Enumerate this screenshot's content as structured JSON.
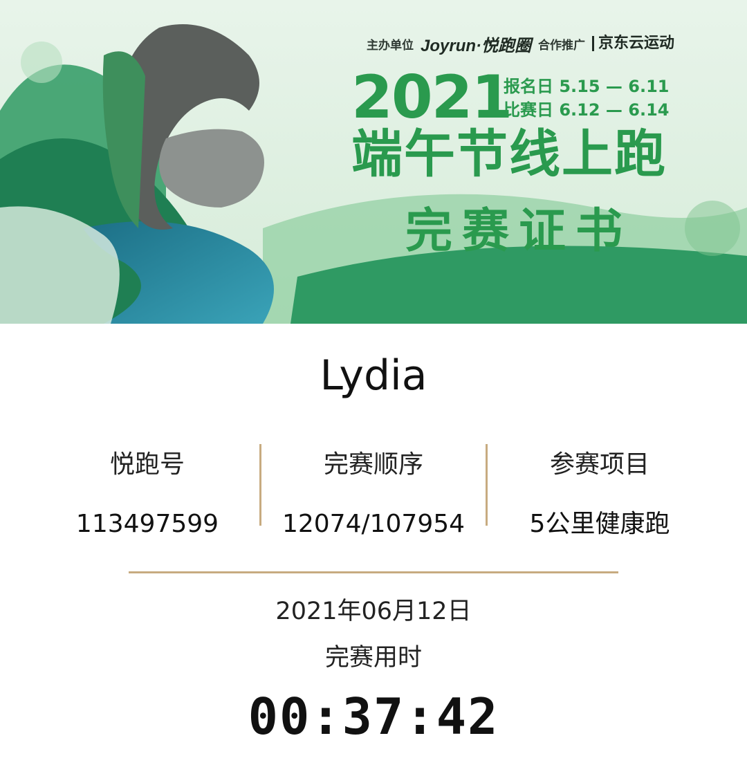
{
  "banner": {
    "sponsor_label": "主办单位",
    "sponsor_name": "Joyrun·悦跑圈",
    "partner_label": "合作推广",
    "partner_name": "京东云运动",
    "year": "2021",
    "register_dates": "报名日 5.15 — 6.11",
    "race_dates": "比赛日 6.12 — 6.14",
    "title": "端午节线上跑",
    "subtitle": "完赛证书",
    "colors": {
      "brand_green": "#2a9a4e",
      "bg_green": "#e3f1e6"
    }
  },
  "runner": {
    "name": "Lydia"
  },
  "stats": [
    {
      "label": "悦跑号",
      "value": "113497599"
    },
    {
      "label": "完赛顺序",
      "value": "12074/107954"
    },
    {
      "label": "参赛项目",
      "value": "5公里健康跑"
    }
  ],
  "finish": {
    "date": "2021年06月12日",
    "time_label": "完赛用时",
    "time": "00:37:42"
  },
  "accent_color": "#c7ab80"
}
